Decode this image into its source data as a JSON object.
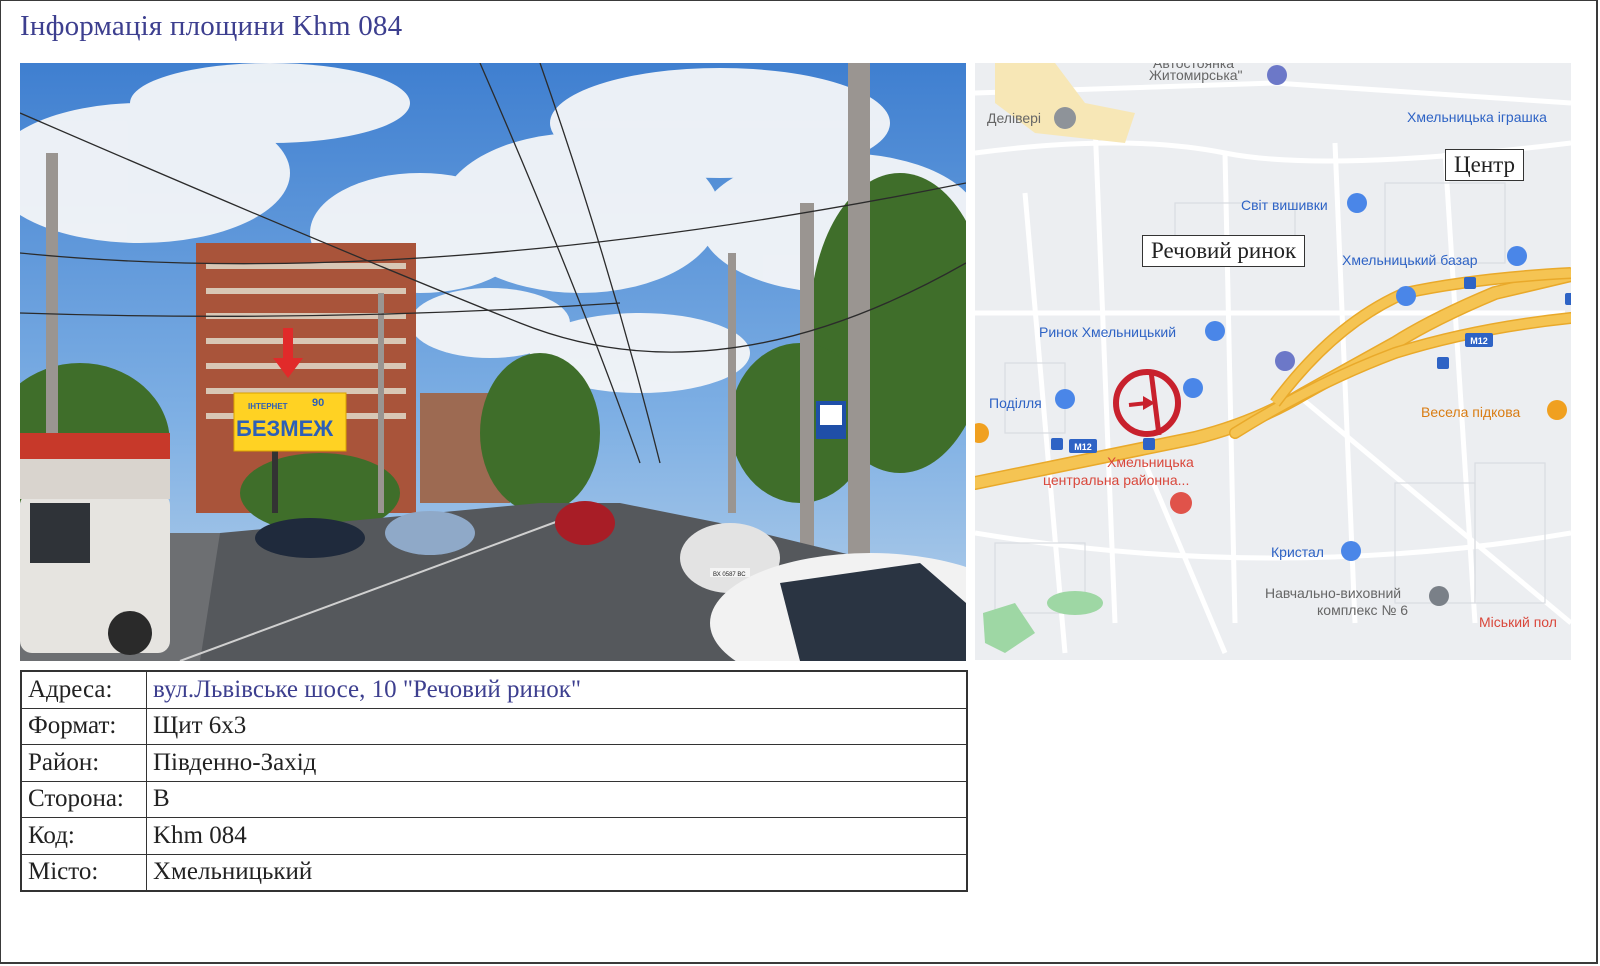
{
  "page": {
    "title": "Інформація площини Khm 084"
  },
  "photo": {
    "billboard_lines": [
      "ІНТЕРНЕТ",
      "БЕЗМЕЖ",
      "90"
    ],
    "plate_text": "ВХ 0587 ВС"
  },
  "map": {
    "labels": {
      "zhytomyrska": "Житомирська\"",
      "zhytomyrska_top": "Автостоянка",
      "deliveri": "Делівері",
      "igrashka": "Хмельницька іграшка",
      "centr": "Центр",
      "svit": "Світ вишивки",
      "rechovyi": "Речовий ринок",
      "bazar": "Хмельницький базар",
      "rynok": "Ринок Хмельницький",
      "podillia": "Поділля",
      "m12_a": "M12",
      "m12_b": "M12",
      "vesela": "Весела підкова",
      "likarnia_1": "Хмельницька",
      "likarnia_2": "центральна районна...",
      "krystal": "Кристал",
      "nvk_1": "Навчально-виховний",
      "nvk_2": "комплекс № 6",
      "miskyi": "Міський пол"
    },
    "colors": {
      "road": "#f5c453",
      "road_edge": "#e9a92a",
      "background": "#eceef1",
      "marker": "#c8212d"
    }
  },
  "info": {
    "rows": [
      {
        "key": "Адреса:",
        "value": "вул.Львівське шосе, 10  \"Речовий ринок\""
      },
      {
        "key": "Формат:",
        "value": "Щит 6х3"
      },
      {
        "key": "Район:",
        "value": "Південно-Захід"
      },
      {
        "key": "Сторона:",
        "value": "B"
      },
      {
        "key": "Код:",
        "value": "Khm 084"
      },
      {
        "key": "Місто:",
        "value": "Хмельницький"
      }
    ]
  }
}
